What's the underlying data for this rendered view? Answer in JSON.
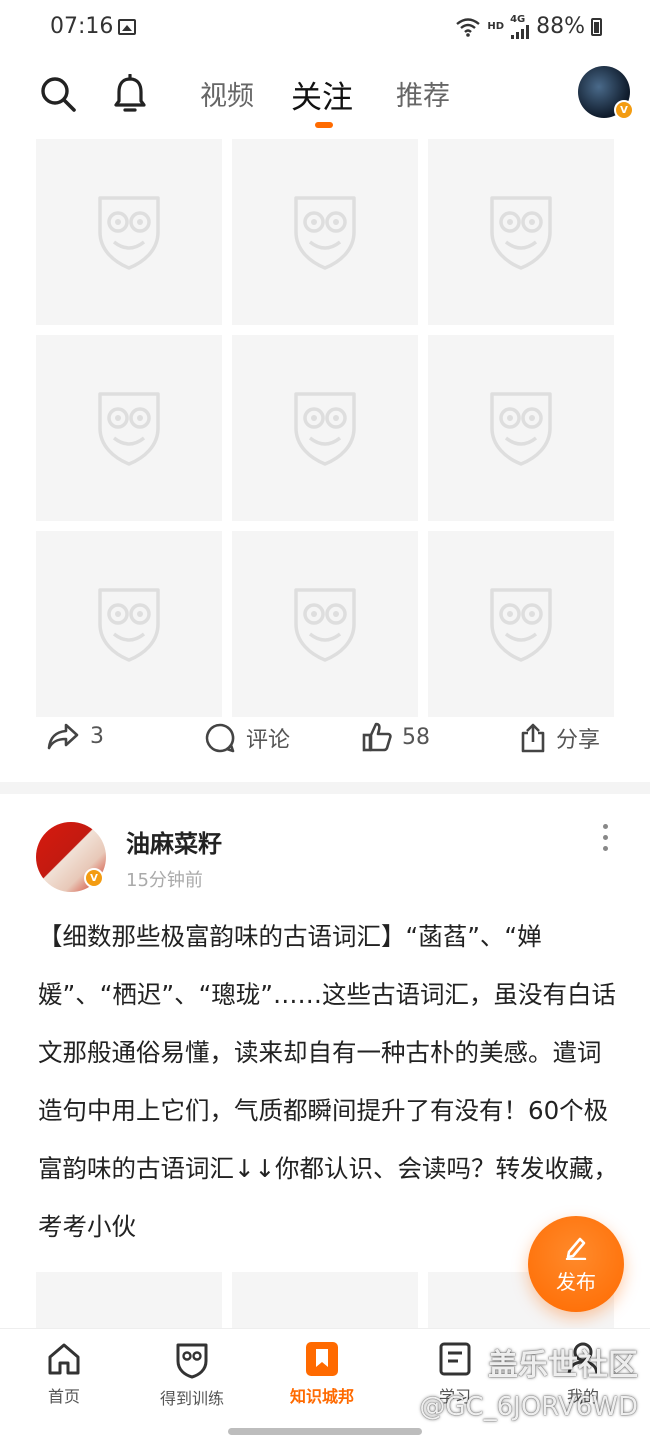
{
  "status_bar": {
    "time": "07:16",
    "network": "HD",
    "signal": "4G",
    "battery": "88%"
  },
  "top_nav": {
    "tabs": [
      "视频",
      "关注",
      "推荐"
    ],
    "active_tab": "关注"
  },
  "feed_item_1": {
    "repost_count": "3",
    "comment_label": "评论",
    "like_count": "58",
    "share_label": "分享"
  },
  "post": {
    "author": "油麻菜籽",
    "time": "15分钟前",
    "verified_badge": "V",
    "text": "【细数那些极富韵味的古语词汇】“菡萏”、“婵媛”、“栖迟”、“璁珑”……这些古语词汇，虽没有白话文那般通俗易懂，读来却自有一种古朴的美感。遣词造句中用上它们，气质都瞬间提升了有没有！60个极富韵味的古语词汇↓↓你都认识、会读吗？转发收藏，考考小伙"
  },
  "fab": {
    "label": "发布"
  },
  "bottom_nav": {
    "items": [
      "首页",
      "得到训练",
      "知识城邦",
      "学习",
      "我的"
    ],
    "active": "知识城邦"
  },
  "watermark": {
    "line1": "盖乐世社区",
    "line2": "@GC_6JORV6WD"
  },
  "colors": {
    "accent": "#ff6a00",
    "badge": "#f39c12"
  }
}
